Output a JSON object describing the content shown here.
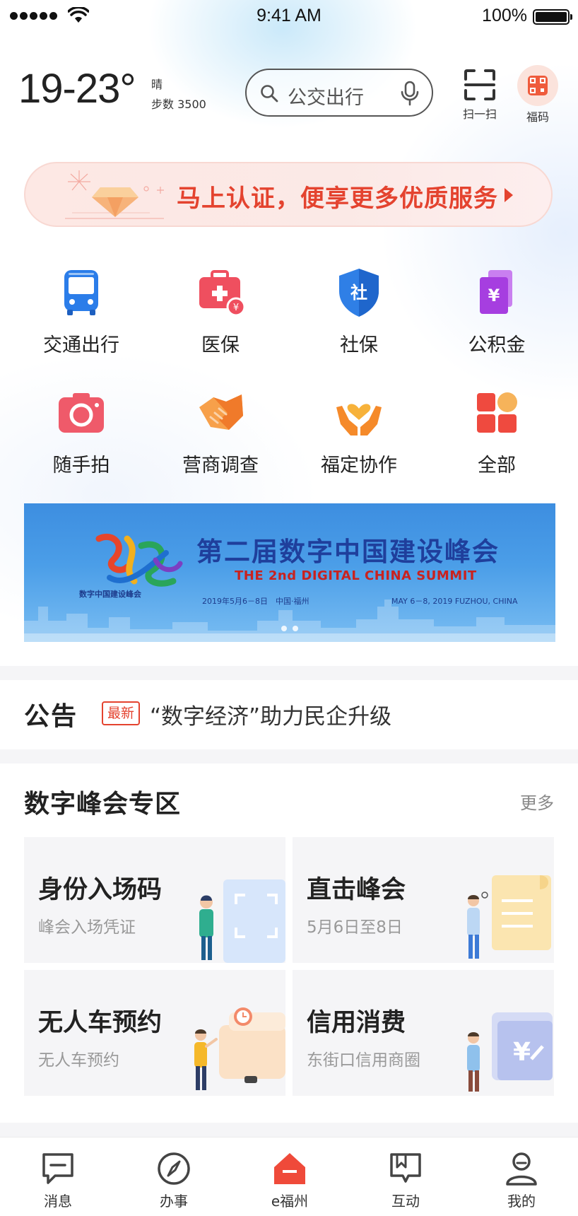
{
  "status_bar": {
    "time": "9:41 AM",
    "battery": "100%"
  },
  "header": {
    "temperature": "19-23°",
    "weather": "晴",
    "steps": "步数 3500",
    "search_placeholder": "公交出行",
    "scan_label": "扫一扫",
    "fuma_label": "福码"
  },
  "auth_banner": {
    "text": "马上认证，便享更多优质服务"
  },
  "services": [
    {
      "label": "交通出行",
      "icon": "bus-icon",
      "color": "#2b7de9"
    },
    {
      "label": "医保",
      "icon": "medical-kit-icon",
      "color": "#ef4f5f"
    },
    {
      "label": "社保",
      "icon": "social-security-shield-icon",
      "color": "#2f7fe6"
    },
    {
      "label": "公积金",
      "icon": "housing-fund-icon",
      "color": "#a63ee0"
    },
    {
      "label": "随手拍",
      "icon": "camera-icon",
      "color": "#ef5a6a"
    },
    {
      "label": "营商调查",
      "icon": "handshake-icon",
      "color": "#f07a2a"
    },
    {
      "label": "福定协作",
      "icon": "heart-hands-icon",
      "color": "#f58a2a"
    },
    {
      "label": "全部",
      "icon": "all-apps-icon",
      "color": "#ef4a3f"
    }
  ],
  "summit_banner": {
    "title_cn": "第二届数字中国建设峰会",
    "title_en": "THE 2nd DIGITAL CHINA SUMMIT",
    "date_cn": "2019年5月6－8日　中国·福州",
    "date_en": "MAY 6－8, 2019 FUZHOU, CHINA",
    "logo_caption": "数字中国建设峰会"
  },
  "notice": {
    "title": "公告",
    "badge": "最新",
    "text": "“数字经济”助力民企升级"
  },
  "summit_zone": {
    "title": "数字峰会专区",
    "more": "更多",
    "cards": [
      {
        "title": "身份入场码",
        "subtitle": "峰会入场凭证"
      },
      {
        "title": "直击峰会",
        "subtitle": "5月6日至8日"
      },
      {
        "title": "无人车预约",
        "subtitle": "无人车预约"
      },
      {
        "title": "信用消费",
        "subtitle": "东街口信用商圈"
      }
    ]
  },
  "bottom_nav": [
    {
      "label": "消息",
      "icon": "message-icon"
    },
    {
      "label": "办事",
      "icon": "compass-icon"
    },
    {
      "label": "e福州",
      "icon": "e-fuzhou-home-icon",
      "color": "#ef4a3a"
    },
    {
      "label": "互动",
      "icon": "interaction-icon"
    },
    {
      "label": "我的",
      "icon": "profile-icon"
    }
  ]
}
